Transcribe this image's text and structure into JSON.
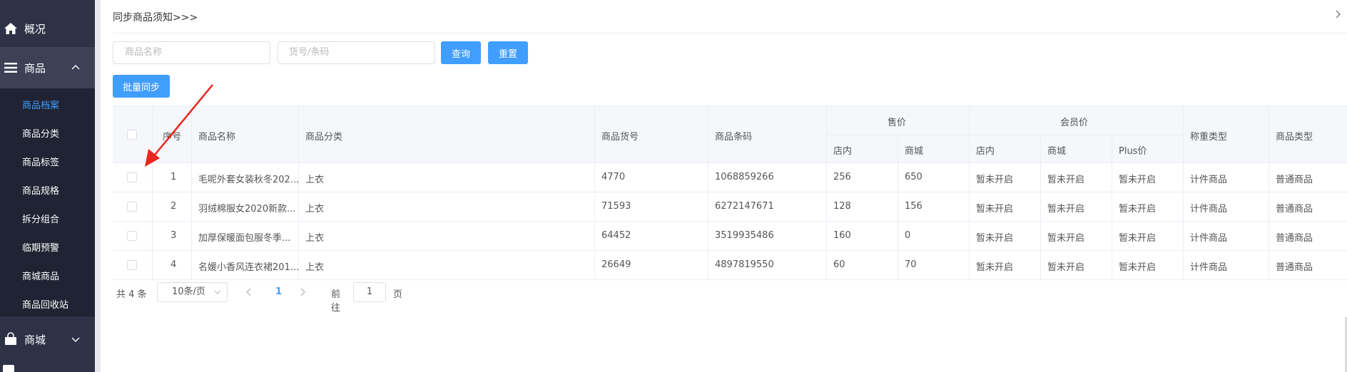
{
  "sidebar": {
    "overview": "概况",
    "goods": "商品",
    "sub_items": [
      "商品档案",
      "商品分类",
      "商品标签",
      "商品规格",
      "拆分组合",
      "临期预警",
      "商城商品",
      "商品回收站"
    ],
    "shop": "商城"
  },
  "breadcrumb": "同步商品须知>>>",
  "search": {
    "name_placeholder": "商品名称",
    "code_placeholder": "货号/条码",
    "query_label": "查询",
    "reset_label": "重置"
  },
  "batch_sync_label": "批量同步",
  "table": {
    "headers": {
      "index": "序号",
      "name": "商品名称",
      "category": "商品分类",
      "sku": "商品货号",
      "barcode": "商品条码",
      "price_group": "售价",
      "price_store": "店内",
      "price_mall": "商城",
      "member_group": "会员价",
      "member_store": "店内",
      "member_mall": "商城",
      "member_plus": "Plus价",
      "weigh_type": "称重类型",
      "goods_type": "商品类型"
    },
    "rows": [
      {
        "index": "1",
        "name": "毛呢外套女装秋冬202...",
        "category": "上衣",
        "sku": "4770",
        "barcode": "1068859266",
        "price_store": "256",
        "price_mall": "650",
        "member_store": "暂未开启",
        "member_mall": "暂未开启",
        "member_plus": "暂未开启",
        "weigh_type": "计件商品",
        "goods_type": "普通商品"
      },
      {
        "index": "2",
        "name": "羽绒棉服女2020新款...",
        "category": "上衣",
        "sku": "71593",
        "barcode": "6272147671",
        "price_store": "128",
        "price_mall": "156",
        "member_store": "暂未开启",
        "member_mall": "暂未开启",
        "member_plus": "暂未开启",
        "weigh_type": "计件商品",
        "goods_type": "普通商品"
      },
      {
        "index": "3",
        "name": "加厚保暖面包服冬季...",
        "category": "上衣",
        "sku": "64452",
        "barcode": "3519935486",
        "price_store": "160",
        "price_mall": "0",
        "member_store": "暂未开启",
        "member_mall": "暂未开启",
        "member_plus": "暂未开启",
        "weigh_type": "计件商品",
        "goods_type": "普通商品"
      },
      {
        "index": "4",
        "name": "名媛小香风连衣裙201...",
        "category": "上衣",
        "sku": "26649",
        "barcode": "4897819550",
        "price_store": "60",
        "price_mall": "70",
        "member_store": "暂未开启",
        "member_mall": "暂未开启",
        "member_plus": "暂未开启",
        "weigh_type": "计件商品",
        "goods_type": "普通商品"
      }
    ]
  },
  "pagination": {
    "total": "共 4 条",
    "page_size": "10条/页",
    "current_page": "1",
    "goto": "前往",
    "goto_value": "1",
    "page_suffix": "页"
  },
  "colors": {
    "sidebar_bg": "#2d3246",
    "submenu_bg": "#1f2333",
    "accent": "#409eff",
    "annotation_arrow": "#e8261c"
  },
  "icons": {
    "overview": "home-icon",
    "goods": "menu-lines-icon",
    "shop": "shopping-bag-icon"
  }
}
